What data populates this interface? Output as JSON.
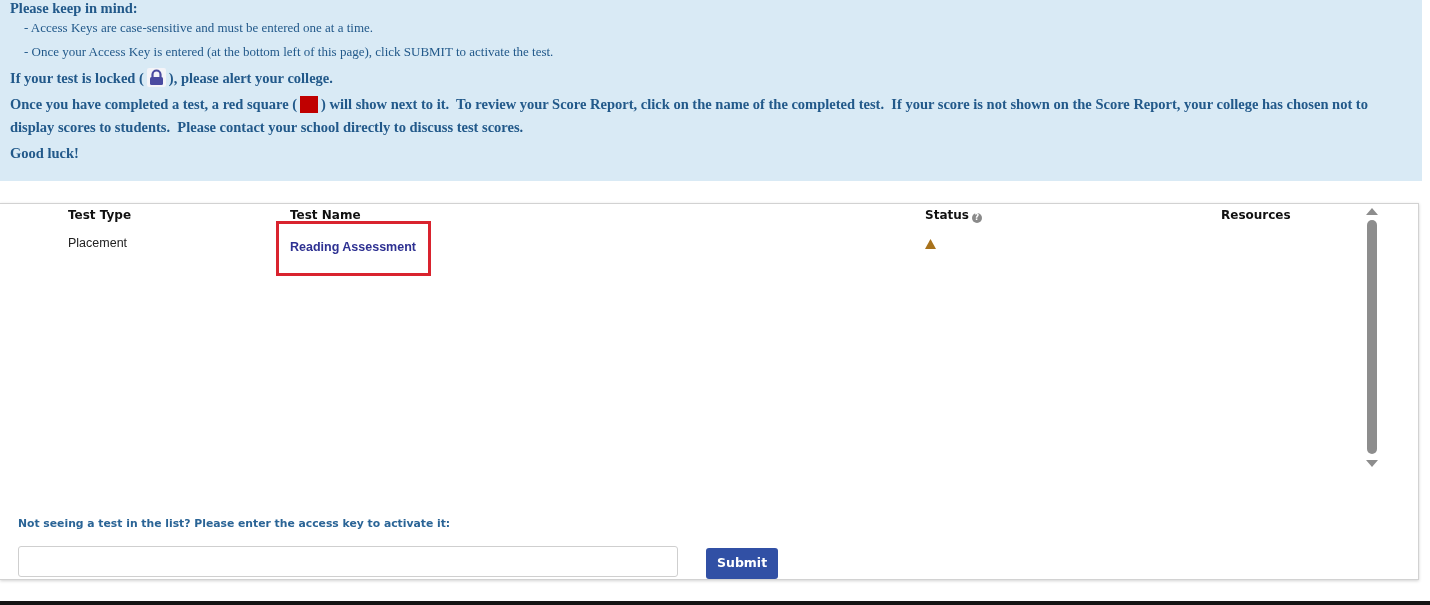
{
  "instructions": {
    "heading": "Please keep in mind:",
    "bullets": [
      "- Access Keys are case-sensitive and must be entered one at a time.",
      "- Once your Access Key is entered (at the bottom left of this page), click SUBMIT to activate the test."
    ],
    "notes": [
      {
        "kind": "locked",
        "before": "If your test is locked (",
        "after": "), please alert your college."
      },
      {
        "kind": "completed",
        "before": "Once you have completed a test, a red square (",
        "after": ") will show next to it.  To review your Score Report, click on the name of the completed test.  If your score is not shown on the Score Report, your college has chosen not to display scores to students.  Please contact your school directly to discuss test scores."
      },
      {
        "kind": "plain",
        "text": "Good luck!"
      }
    ]
  },
  "table": {
    "columns": [
      {
        "label": "Test Type"
      },
      {
        "label": "Test Name"
      },
      {
        "label": "Status",
        "help": "?"
      },
      {
        "label": "Resources"
      }
    ],
    "rows": [
      {
        "test_type": "Placement",
        "test_name": "Reading Assessment",
        "status": {
          "kind": "alert"
        },
        "highlighted": true
      }
    ]
  },
  "access_key": {
    "label": "Not seeing a test in the list? Please enter the access key to activate it:",
    "button": "Submit"
  }
}
